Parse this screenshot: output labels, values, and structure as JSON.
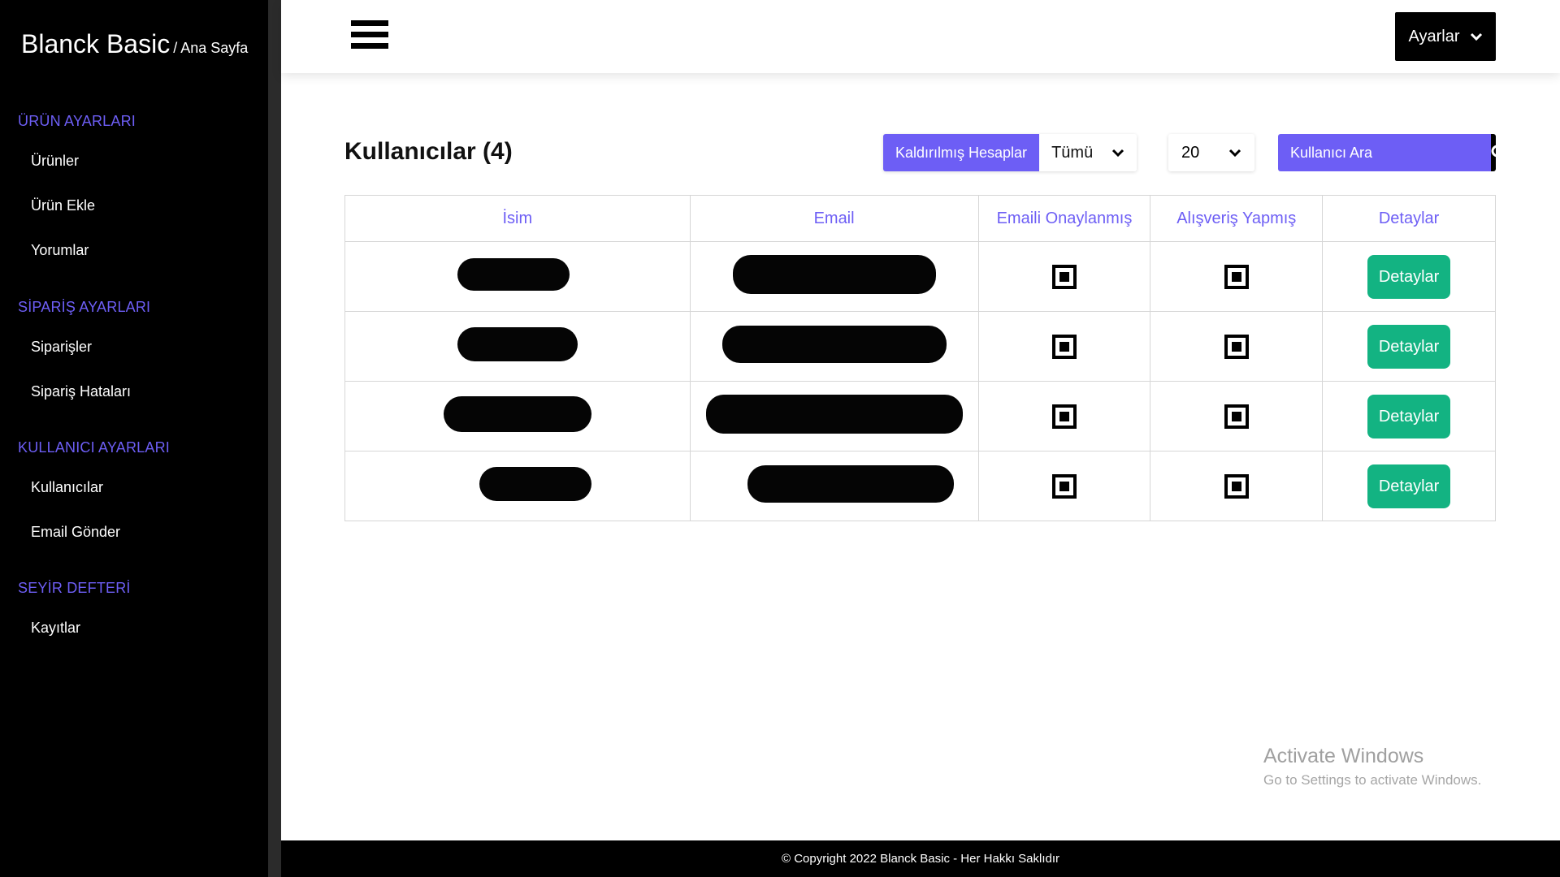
{
  "brand": {
    "name": "Blanck Basic",
    "sub": "/ Ana Sayfa"
  },
  "sidebar": {
    "sections": [
      {
        "title": "ÜRÜN AYARLARI",
        "items": [
          "Ürünler",
          "Ürün Ekle",
          "Yorumlar"
        ]
      },
      {
        "title": "SİPARİŞ AYARLARI",
        "items": [
          "Siparişler",
          "Sipariş Hataları"
        ]
      },
      {
        "title": "KULLANICI AYARLARI",
        "items": [
          "Kullanıcılar",
          "Email Gönder"
        ]
      },
      {
        "title": "SEYİR DEFTERİ",
        "items": [
          "Kayıtlar"
        ]
      }
    ]
  },
  "topbar": {
    "menu_icon": "hamburger-icon",
    "settings_label": "Ayarlar"
  },
  "main": {
    "title": "Kullanıcılar (4)",
    "filter": {
      "label": "Kaldırılmış Hesaplar",
      "selected": "Tümü"
    },
    "page_size": "20",
    "search": {
      "placeholder": "Kullanıcı Ara"
    }
  },
  "table": {
    "headers": [
      "İsim",
      "Email",
      "Emaili Onaylanmış",
      "Alışveriş Yapmış",
      "Detaylar"
    ],
    "rows": [
      {
        "name": "[redacted]",
        "email": "[redacted]",
        "email_verified": true,
        "has_purchased": true,
        "detail_label": "Detaylar"
      },
      {
        "name": "[redacted]",
        "email": "[redacted]",
        "email_verified": true,
        "has_purchased": true,
        "detail_label": "Detaylar"
      },
      {
        "name": "[redacted]",
        "email": "[redacted]",
        "email_verified": true,
        "has_purchased": true,
        "detail_label": "Detaylar"
      },
      {
        "name": "[redacted]",
        "email": "[redacted]",
        "email_verified": true,
        "has_purchased": true,
        "detail_label": "Detaylar"
      }
    ]
  },
  "watermark": {
    "title": "Activate Windows",
    "subtitle": "Go to Settings to activate Windows."
  },
  "footer": {
    "text": "© Copyright 2022 Blanck Basic - Her Hakkı Saklıdır"
  },
  "colors": {
    "accent": "#6d5ef5",
    "success": "#13b382",
    "sidebar_bg": "#000000"
  }
}
